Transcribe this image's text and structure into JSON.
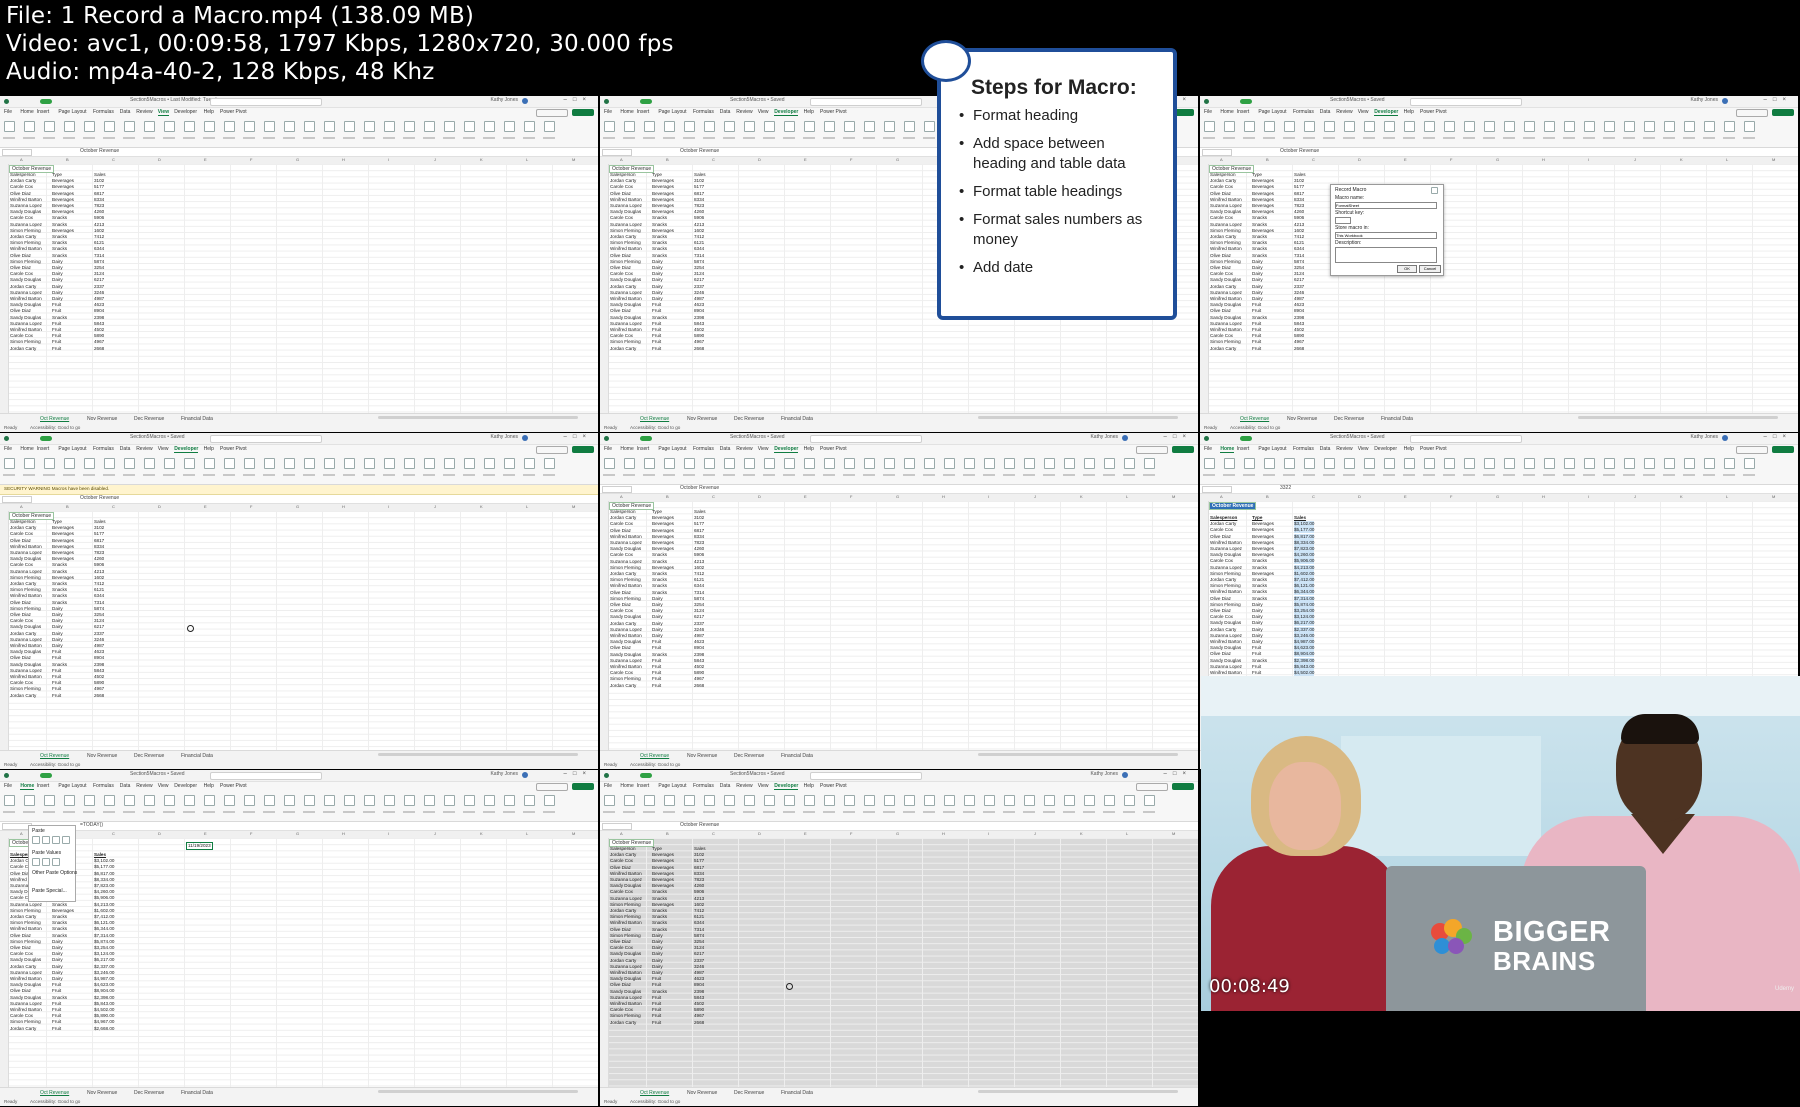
{
  "header": {
    "line1": "File: 1  Record a Macro.mp4 (138.09 MB)",
    "line2": "Video: avc1, 00:09:58, 1797 Kbps, 1280x720, 30.000 fps",
    "line3": "Audio: mp4a-40-2, 128 Kbps, 48 Khz"
  },
  "excel": {
    "file_title": "Section5Macros • Saved",
    "file_title_1": "Section5Macros • Last Modified: Tuesday",
    "search": "Search (Alt+Q)",
    "user": "Kathy Jones",
    "menu_home": [
      "File",
      "Home",
      "Insert",
      "Page Layout",
      "Formulas",
      "Data",
      "Review",
      "View",
      "Developer",
      "Help",
      "Power Pivot"
    ],
    "name_box": "A3",
    "formula_value": "October Revenue",
    "formula_value_9": "=TODAY()",
    "formula_value_6": "3322",
    "sheet_title": "October Revenue",
    "columns": [
      "A",
      "B",
      "C",
      "D",
      "E",
      "F",
      "G",
      "H",
      "I",
      "J",
      "K",
      "L",
      "M",
      "N"
    ],
    "col_headers": [
      "Salesperson",
      "Type",
      "Sales"
    ],
    "rows": [
      [
        "Jordan Carty",
        "Beverages",
        "3102"
      ],
      [
        "Carole Cox",
        "Beverages",
        "5177"
      ],
      [
        "Olive Diaz",
        "Beverages",
        "6817"
      ],
      [
        "Winifred Barton",
        "Beverages",
        "8334"
      ],
      [
        "Suzanna Lopez",
        "Beverages",
        "7823"
      ],
      [
        "Sandy Douglas",
        "Beverages",
        "4260"
      ],
      [
        "Carole Cox",
        "Snacks",
        "5906"
      ],
      [
        "Suzanna Lopez",
        "Snacks",
        "4213"
      ],
      [
        "Simon Fleming",
        "Beverages",
        "1602"
      ],
      [
        "Jordan Carty",
        "Snacks",
        "7412"
      ],
      [
        "Simon Fleming",
        "Snacks",
        "6121"
      ],
      [
        "Winifred Barton",
        "Snacks",
        "6344"
      ],
      [
        "Olive Diaz",
        "Snacks",
        "7314"
      ],
      [
        "Simon Fleming",
        "Dairy",
        "5874"
      ],
      [
        "Olive Diaz",
        "Dairy",
        "3254"
      ],
      [
        "Carole Cox",
        "Dairy",
        "3124"
      ],
      [
        "Sandy Douglas",
        "Dairy",
        "6217"
      ],
      [
        "Jordan Carty",
        "Dairy",
        "2337"
      ],
      [
        "Suzanna Lopez",
        "Dairy",
        "3246"
      ],
      [
        "Winifred Barton",
        "Dairy",
        "4987"
      ],
      [
        "Sandy Douglas",
        "Fruit",
        "4623"
      ],
      [
        "Olive Diaz",
        "Fruit",
        "8904"
      ],
      [
        "Sandy Douglas",
        "Snacks",
        "2398"
      ],
      [
        "Suzanna Lopez",
        "Fruit",
        "5843"
      ],
      [
        "Winifred Barton",
        "Fruit",
        "4502"
      ],
      [
        "Carole Cox",
        "Fruit",
        "5890"
      ],
      [
        "Simon Fleming",
        "Fruit",
        "4967"
      ],
      [
        "Jordan Carty",
        "Fruit",
        "2668"
      ]
    ],
    "money_rows": [
      "$3,102.00",
      "$5,177.00",
      "$6,817.00",
      "$8,334.00",
      "$7,823.00",
      "$4,260.00",
      "$5,906.00",
      "$4,213.00",
      "$1,602.00",
      "$7,412.00",
      "$6,121.00",
      "$6,344.00",
      "$7,314.00",
      "$5,874.00",
      "$3,254.00",
      "$3,124.00",
      "$6,217.00",
      "$2,337.00",
      "$3,246.00",
      "$4,987.00",
      "$4,623.00",
      "$8,904.00",
      "$2,398.00",
      "$5,843.00",
      "$4,502.00",
      "$5,890.00",
      "$4,967.00",
      "$2,668.00"
    ],
    "tabs": [
      "Oct Revenue",
      "Nov Revenue",
      "Dec Revenue",
      "Financial Data"
    ],
    "status_ready": "Ready",
    "status_access": "Accessibility: Good to go",
    "date_cell": "11/19/2023",
    "security_warning": "SECURITY WARNING  Macros have been disabled.",
    "enable_content": "Enable Content"
  },
  "slide": {
    "title": "Steps for Macro:",
    "bullets": [
      "Format heading",
      "Add space between heading and table data",
      "Format table headings",
      "Format sales numbers as money",
      "Add date"
    ]
  },
  "dialog": {
    "title": "Record Macro",
    "macro_name_label": "Macro name:",
    "macro_name_value": "FormatSheet",
    "shortcut_label": "Shortcut key:",
    "store_label": "Store macro in:",
    "store_value": "This Workbook",
    "desc_label": "Description:",
    "ok": "OK",
    "cancel": "Cancel"
  },
  "paste_menu": {
    "title": "Paste",
    "values": "Paste Values",
    "other": "Other Paste Options",
    "special": "Paste Special..."
  },
  "video": {
    "brand_line1": "BIGGER",
    "brand_line2": "BRAINS",
    "timecode": "00:08:49",
    "watermark": "Udemy"
  },
  "colors": {
    "excel_green": "#107c41",
    "slide_border": "#1f4e99",
    "woman_top": "#9b2333",
    "man_shirt": "#e9b6c4"
  }
}
